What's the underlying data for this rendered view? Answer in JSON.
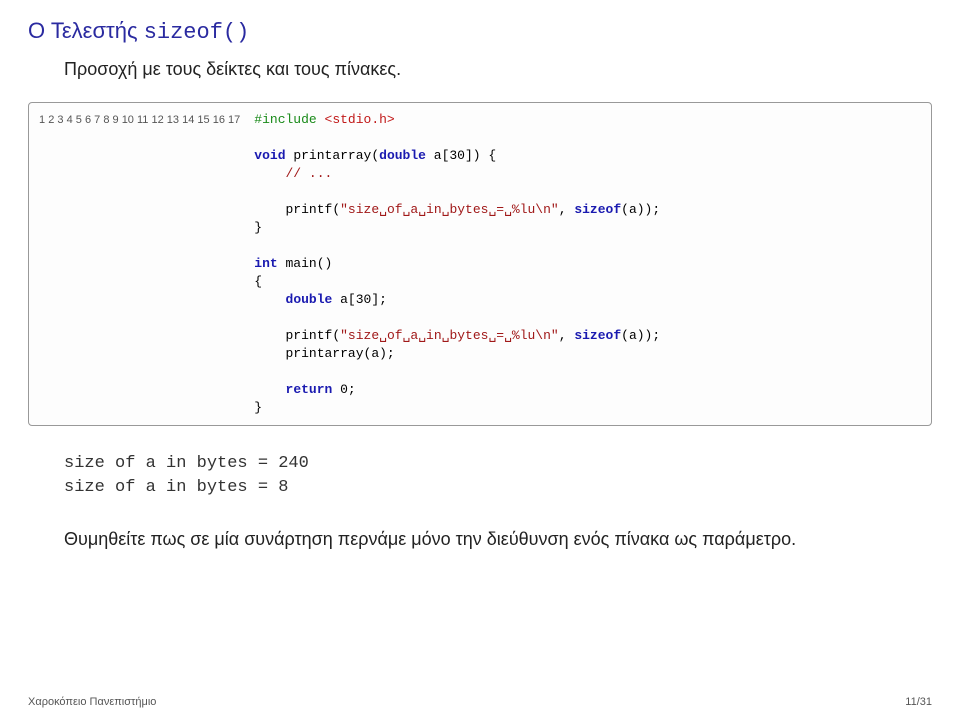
{
  "title_prefix": "Ο Τελεστής ",
  "title_kw": "sizeof()",
  "subtitle": "Προσοχή με τους δείκτες και τους πίνακες.",
  "code": {
    "line1_a": "#include",
    "line1_b": " <stdio.h>",
    "line3_a": "void",
    "line3_b": " printarray",
    "line3_c": "(",
    "line3_d": "double",
    "line3_e": " a[30]) {",
    "line4": "    // ...",
    "line6_a": "    printf",
    "line6_b": "(",
    "line6_c": "\"size␣of␣a␣in␣bytes␣=␣%lu\\n\"",
    "line6_d": ", ",
    "line6_e": "sizeof",
    "line6_f": "(a));",
    "line7": "}",
    "line9_a": "int",
    "line9_b": " main",
    "line9_c": "()",
    "line10": "{",
    "line11_a": "    ",
    "line11_b": "double",
    "line11_c": " a[30];",
    "line13_a": "    printf",
    "line13_b": "(",
    "line13_c": "\"size␣of␣a␣in␣bytes␣=␣%lu\\n\"",
    "line13_d": ", ",
    "line13_e": "sizeof",
    "line13_f": "(a));",
    "line14_a": "    printarray",
    "line14_b": "(a);",
    "line16_a": "    ",
    "line16_b": "return",
    "line16_c": " 0;",
    "line17": "}"
  },
  "lineno": [
    "1",
    "2",
    "3",
    "4",
    "5",
    "6",
    "7",
    "8",
    "9",
    "10",
    "11",
    "12",
    "13",
    "14",
    "15",
    "16",
    "17"
  ],
  "output_l1": "size of a in bytes = 240",
  "output_l2": "size of a in bytes = 8",
  "note": "Θυμηθείτε πως σε μία συνάρτηση περνάμε μόνο την διεύθυνση ενός πίνακα ως παράμετρο.",
  "footer_left": "Χαροκόπειο Πανεπιστήμιο",
  "footer_right": "11/31"
}
